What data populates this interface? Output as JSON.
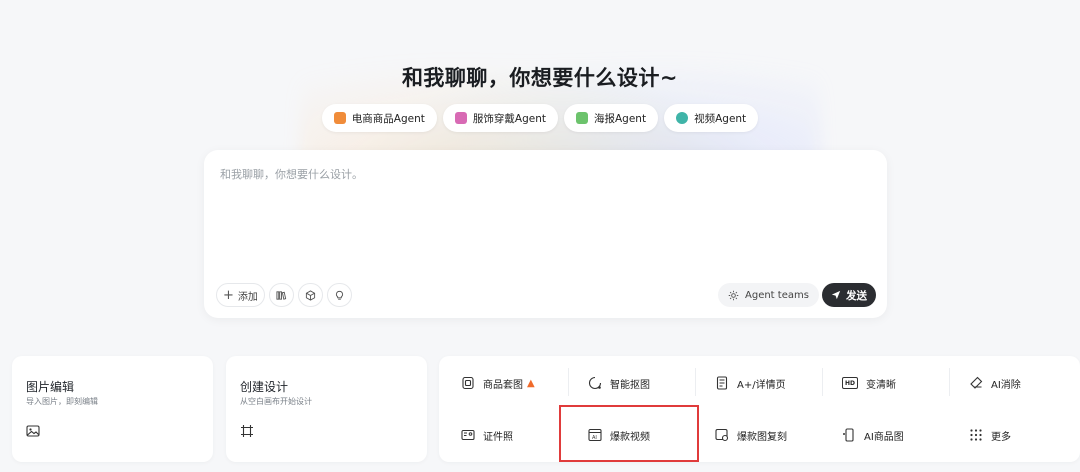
{
  "title": "和我聊聊，你想要什么设计~",
  "pills": [
    {
      "label": "电商商品Agent",
      "icon": "truck-icon",
      "color": "#f08c3a"
    },
    {
      "label": "服饰穿戴Agent",
      "icon": "shirt-icon",
      "color": "#d86ab4"
    },
    {
      "label": "海报Agent",
      "icon": "poster-icon",
      "color": "#6cc36c"
    },
    {
      "label": "视频Agent",
      "icon": "video-icon",
      "color": "#3fb4a8"
    }
  ],
  "chat": {
    "placeholder": "和我聊聊，你想要什么设计。",
    "add_label": "添加",
    "agent_teams_label": "Agent teams",
    "send_label": "发送"
  },
  "cards": [
    {
      "title": "图片编辑",
      "subtitle": "导入图片，即刻编辑",
      "icon": "image-icon"
    },
    {
      "title": "创建设计",
      "subtitle": "从空白画布开始设计",
      "icon": "canvas-icon"
    }
  ],
  "tools": [
    {
      "label": "商品套图",
      "icon": "product-set-icon",
      "badge": "fire-icon"
    },
    {
      "label": "智能抠图",
      "icon": "cutout-icon"
    },
    {
      "label": "A+/详情页",
      "icon": "detail-page-icon"
    },
    {
      "label": "变清晰",
      "icon": "hd-icon"
    },
    {
      "label": "AI消除",
      "icon": "eraser-icon"
    },
    {
      "label": "证件照",
      "icon": "id-photo-icon"
    },
    {
      "label": "爆款视频",
      "icon": "ai-video-icon"
    },
    {
      "label": "爆款图复刻",
      "icon": "replicate-icon"
    },
    {
      "label": "AI商品图",
      "icon": "ai-product-icon"
    },
    {
      "label": "更多",
      "icon": "grid-dots-icon"
    }
  ],
  "highlight_color": "#e03b3b"
}
